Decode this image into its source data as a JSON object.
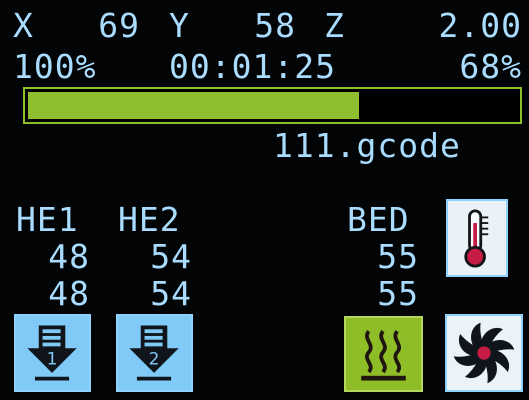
{
  "status": {
    "x_label": "X",
    "x_value": "69",
    "y_label": "Y",
    "y_value": "58",
    "z_label": "Z",
    "z_value": "2.00",
    "feed_rate": "100%",
    "elapsed_time": "00:01:25",
    "progress_percent_text": "68%"
  },
  "progress": {
    "value_percent": 68,
    "fill_color": "#8ebe2f",
    "border_color": "#8ebf2b"
  },
  "file": {
    "name": "111.gcode"
  },
  "temperatures": {
    "he1_label": "HE1",
    "he2_label": "HE2",
    "bed_label": "BED",
    "he1_current": "48",
    "he2_current": "54",
    "bed_current": "55",
    "he1_target": "48",
    "he2_target": "54",
    "bed_target": "55"
  },
  "buttons": {
    "temperature_icon": "thermometer-icon",
    "extruder1_icon": "extruder-1-icon",
    "extruder1_number": "1",
    "extruder2_icon": "extruder-2-icon",
    "extruder2_number": "2",
    "bed_heat_icon": "heated-bed-icon",
    "fan_icon": "fan-icon"
  },
  "colors": {
    "background": "#030405",
    "text": "#a9dcff",
    "button_blue": "#7fcaf7",
    "button_green": "#8fbd28",
    "icon_dark": "#111418",
    "icon_red": "#c51c45"
  }
}
